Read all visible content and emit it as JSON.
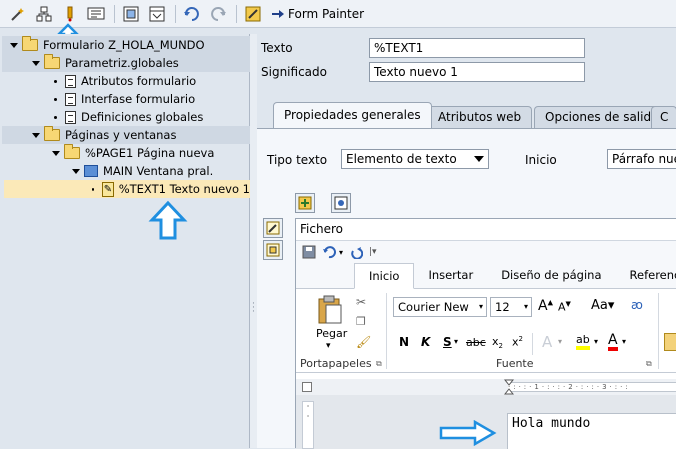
{
  "toolbar": {
    "icons": [
      "wand-icon",
      "hierarchy-icon",
      "info-icon",
      "display-icon",
      "page-icon",
      "window-icon",
      "undo-icon",
      "redo-icon",
      "painter-icon"
    ],
    "form_painter_label": "Form Painter"
  },
  "tree": {
    "root": "Formulario Z_HOLA_MUNDO",
    "globals": "Parametriz.globales",
    "globals_items": [
      "Atributos formulario",
      "Interfase formulario",
      "Definiciones globales"
    ],
    "pages": "Páginas y ventanas",
    "page1": "%PAGE1 Página nueva",
    "main": "MAIN Ventana pral.",
    "selected": "%TEXT1 Texto nuevo 1"
  },
  "header": {
    "texto_label": "Texto",
    "texto_value": "%TEXT1",
    "significado_label": "Significado",
    "significado_value": "Texto nuevo 1"
  },
  "tabs": [
    "Propiedades generales",
    "Atributos web",
    "Opciones de salida",
    "C"
  ],
  "props": {
    "tipo_label": "Tipo texto",
    "tipo_value": "Elemento de texto",
    "inicio_label": "Inicio",
    "inicio_value": "Párrafo nuevo"
  },
  "word": {
    "menu": "Fichero",
    "ribbon_tabs": [
      "Inicio",
      "Insertar",
      "Diseño de página",
      "Referencias"
    ],
    "paste_label": "Pegar",
    "clipboard_label": "Portapapeles",
    "font_label": "Fuente",
    "font_name": "Courier New",
    "font_size": "12",
    "document_text": "Hola mundo"
  },
  "colors": {
    "arrow": "#1f8fe0",
    "selected_row": "#fbe9b8"
  }
}
